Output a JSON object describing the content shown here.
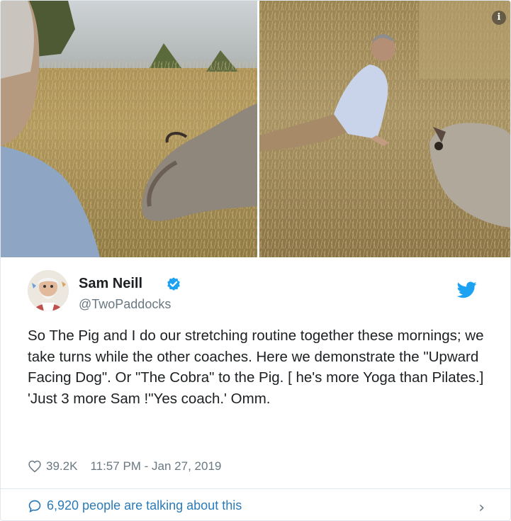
{
  "tweet": {
    "author": {
      "name": "Sam Neill",
      "handle": "@TwoPaddocks",
      "verified": true
    },
    "text": "So The Pig and I do our stretching routine together these mornings; we take turns while the other coaches. Here we demonstrate the \"Upward Facing Dog\". Or \"The Cobra\" to the Pig. [ he's more Yoga than Pilates.] 'Just 3 more Sam !\"Yes coach.' Omm.",
    "likes": "39.2K",
    "timestamp": "11:57 PM - Jan 27, 2019",
    "conversation": "6,920 people are talking about this"
  },
  "icons": {
    "info": "info-icon",
    "verified": "verified-badge-icon",
    "brand": "twitter-bird-icon",
    "like": "heart-icon",
    "conversation": "speech-bubble-icon",
    "more": "chevron-right-icon"
  },
  "colors": {
    "accent": "#1da1f2",
    "link": "#2b7bb9",
    "muted": "#697882",
    "text": "#1c2022"
  }
}
